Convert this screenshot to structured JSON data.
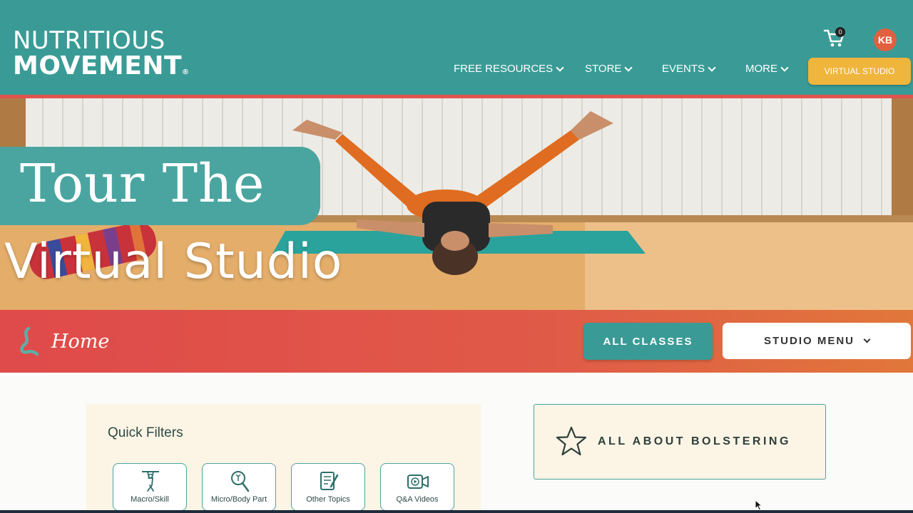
{
  "header": {
    "logo": {
      "line1": "NUTRITIOUS",
      "line2": "MOVEMENT",
      "mark": "®"
    },
    "nav": [
      {
        "label": "FREE RESOURCES",
        "icon": "chevron-down-icon"
      },
      {
        "label": "STORE",
        "icon": "chevron-down-icon"
      },
      {
        "label": "EVENTS",
        "icon": "chevron-down-icon"
      },
      {
        "label": "MORE",
        "icon": "chevron-down-icon"
      }
    ],
    "cta_label": "VIRTUAL STUDIO",
    "cart": {
      "icon": "cart-icon",
      "count": "0"
    },
    "avatar_initials": "KB"
  },
  "hero": {
    "line1": "Tour The",
    "line2": "Virtual Studio"
  },
  "band": {
    "home_icon": "brand-squiggle-icon",
    "home_label": "Home",
    "all_classes_label": "ALL CLASSES",
    "studio_menu_label": "STUDIO MENU"
  },
  "quick_filters": {
    "title": "Quick Filters",
    "items": [
      {
        "label": "Macro/Skill",
        "icon": "figure-hang-icon"
      },
      {
        "label": "Micro/Body Part",
        "icon": "magnifier-body-icon"
      },
      {
        "label": "Other Topics",
        "icon": "document-pen-icon"
      },
      {
        "label": "Q&A Videos",
        "icon": "video-camera-icon"
      }
    ]
  },
  "featured": {
    "label": "ALL ABOUT BOLSTERING",
    "icon": "star-icon"
  },
  "colors": {
    "teal": "#3a9b96",
    "red": "#df4a4a",
    "orange": "#e1773a",
    "gold": "#f0b53c",
    "cream": "#fcf4e4"
  }
}
